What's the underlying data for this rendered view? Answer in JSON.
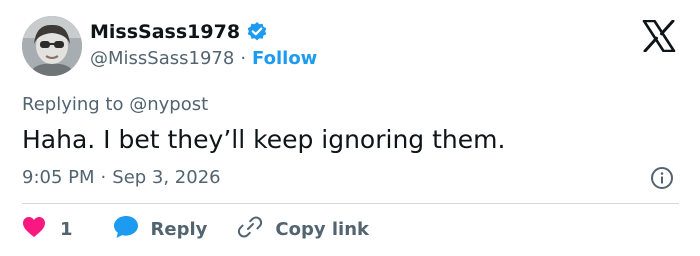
{
  "author": {
    "display_name": "MissSass1978",
    "handle": "@MissSass1978",
    "separator": "·",
    "follow_label": "Follow"
  },
  "reply_context": {
    "prefix": "Replying to ",
    "mention": "@nypost"
  },
  "tweet": {
    "text": "Haha. I bet they’ll keep ignoring them.",
    "time": "9:05 PM",
    "separator": "·",
    "date": "Sep 3, 2026"
  },
  "actions": {
    "like_count": "1",
    "reply_label": "Reply",
    "copy_link_label": "Copy link"
  },
  "colors": {
    "accent": "#1d9bf0",
    "like": "#f91880",
    "text": "#0f1419",
    "muted": "#536471",
    "divider": "#cfd9de"
  },
  "icons": {
    "verified": "verified-badge-icon",
    "logo": "x-logo-icon",
    "info": "info-icon",
    "like": "heart-icon",
    "reply": "speech-bubble-icon",
    "copy": "link-icon"
  }
}
